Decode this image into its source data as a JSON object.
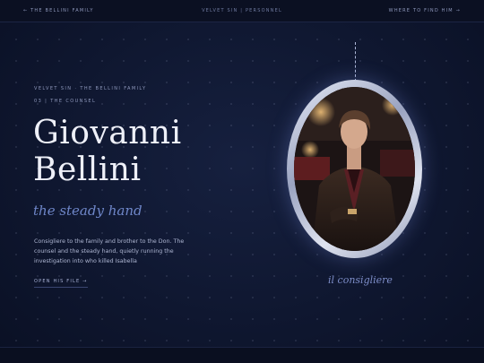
{
  "topbar": {
    "back": "← THE BELLINI FAMILY",
    "center": "VELVET SIN | PERSONNEL",
    "find": "WHERE TO FIND HIM →"
  },
  "profile": {
    "series": "VELVET SIN · THE BELLINI FAMILY",
    "index": "03 | THE COUNSEL",
    "first_name": "Giovanni",
    "last_name": "Bellini",
    "tagline": "the steady hand",
    "description": "Consigliere to the family and brother to the Don. The counsel and the steady hand, quietly running the investigation into who killed Isabella",
    "cta": "OPEN HIS FILE →"
  },
  "portrait": {
    "caption": "il consigliere"
  }
}
